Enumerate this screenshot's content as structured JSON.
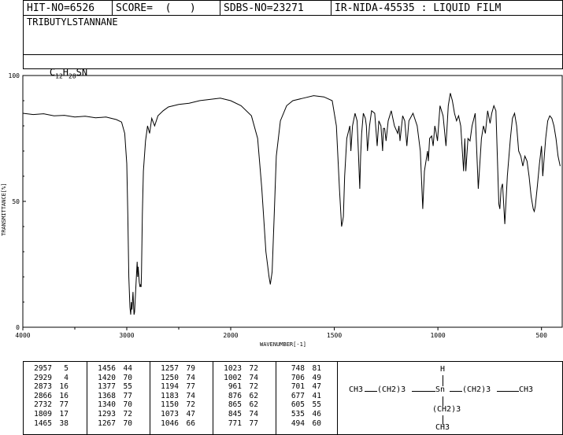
{
  "header": {
    "hit_no": "HIT-NO=6526",
    "score": "SCORE=  (   )",
    "sdbs_no": "SDBS-NO=23271",
    "ir_info": "IR-NIDA-45535 : LIQUID FILM"
  },
  "compound": {
    "name": "TRIBUTYLSTANNANE",
    "formula_parts": [
      "C",
      "12",
      "H",
      "28",
      "SN"
    ]
  },
  "chart_data": {
    "type": "line",
    "xlabel": "WAVENUMBER[-1]",
    "ylabel": "TRANSMITTANCE[%]",
    "xlim": [
      4000,
      400
    ],
    "ylim": [
      0,
      100
    ],
    "x_ticks": [
      "4000",
      "3000",
      "2000",
      "1500",
      "1000",
      "500"
    ],
    "y_ticks": [
      "100",
      "50",
      "0"
    ],
    "grid": false,
    "series": [
      {
        "points": [
          [
            4000,
            85
          ],
          [
            3900,
            84.5
          ],
          [
            3800,
            84.8
          ],
          [
            3700,
            84
          ],
          [
            3600,
            84.2
          ],
          [
            3500,
            83.5
          ],
          [
            3400,
            83.8
          ],
          [
            3300,
            83.2
          ],
          [
            3200,
            83.5
          ],
          [
            3100,
            82.5
          ],
          [
            3050,
            81.5
          ],
          [
            3020,
            77
          ],
          [
            3000,
            65
          ],
          [
            2990,
            45
          ],
          [
            2980,
            20
          ],
          [
            2970,
            8
          ],
          [
            2962,
            5
          ],
          [
            2955,
            10
          ],
          [
            2950,
            7
          ],
          [
            2940,
            14
          ],
          [
            2930,
            5
          ],
          [
            2925,
            6
          ],
          [
            2915,
            14
          ],
          [
            2900,
            26
          ],
          [
            2895,
            20
          ],
          [
            2890,
            24
          ],
          [
            2880,
            18
          ],
          [
            2873,
            16
          ],
          [
            2868,
            17
          ],
          [
            2862,
            16
          ],
          [
            2858,
            22
          ],
          [
            2850,
            45
          ],
          [
            2840,
            62
          ],
          [
            2820,
            74
          ],
          [
            2800,
            80
          ],
          [
            2780,
            77
          ],
          [
            2760,
            83
          ],
          [
            2732,
            80
          ],
          [
            2700,
            84
          ],
          [
            2650,
            86
          ],
          [
            2600,
            87.5
          ],
          [
            2500,
            88.5
          ],
          [
            2400,
            89
          ],
          [
            2300,
            90
          ],
          [
            2200,
            90.5
          ],
          [
            2100,
            91
          ],
          [
            2050,
            90.5
          ],
          [
            2000,
            90
          ],
          [
            1950,
            88
          ],
          [
            1900,
            84
          ],
          [
            1870,
            75
          ],
          [
            1850,
            55
          ],
          [
            1830,
            30
          ],
          [
            1815,
            20
          ],
          [
            1809,
            17
          ],
          [
            1800,
            22
          ],
          [
            1790,
            45
          ],
          [
            1780,
            68
          ],
          [
            1760,
            82
          ],
          [
            1730,
            88
          ],
          [
            1700,
            90
          ],
          [
            1650,
            91
          ],
          [
            1600,
            92
          ],
          [
            1550,
            91.5
          ],
          [
            1510,
            90
          ],
          [
            1490,
            80
          ],
          [
            1475,
            55
          ],
          [
            1465,
            40
          ],
          [
            1460,
            42
          ],
          [
            1456,
            44
          ],
          [
            1450,
            60
          ],
          [
            1440,
            75
          ],
          [
            1425,
            80
          ],
          [
            1420,
            70
          ],
          [
            1412,
            80
          ],
          [
            1400,
            85
          ],
          [
            1390,
            82
          ],
          [
            1384,
            70
          ],
          [
            1377,
            55
          ],
          [
            1373,
            68
          ],
          [
            1368,
            77
          ],
          [
            1360,
            85
          ],
          [
            1350,
            83
          ],
          [
            1345,
            80
          ],
          [
            1340,
            70
          ],
          [
            1330,
            80
          ],
          [
            1320,
            86
          ],
          [
            1305,
            85
          ],
          [
            1293,
            72
          ],
          [
            1285,
            82
          ],
          [
            1275,
            80
          ],
          [
            1267,
            70
          ],
          [
            1263,
            79
          ],
          [
            1257,
            79
          ],
          [
            1250,
            74
          ],
          [
            1240,
            82
          ],
          [
            1225,
            86
          ],
          [
            1210,
            80
          ],
          [
            1194,
            77
          ],
          [
            1188,
            80
          ],
          [
            1183,
            74
          ],
          [
            1170,
            84
          ],
          [
            1160,
            82
          ],
          [
            1150,
            72
          ],
          [
            1140,
            82
          ],
          [
            1120,
            85
          ],
          [
            1100,
            80
          ],
          [
            1085,
            70
          ],
          [
            1073,
            47
          ],
          [
            1065,
            62
          ],
          [
            1050,
            70
          ],
          [
            1046,
            66
          ],
          [
            1040,
            75
          ],
          [
            1030,
            76
          ],
          [
            1023,
            72
          ],
          [
            1015,
            80
          ],
          [
            1010,
            78
          ],
          [
            1002,
            74
          ],
          [
            990,
            88
          ],
          [
            975,
            84
          ],
          [
            961,
            72
          ],
          [
            950,
            88
          ],
          [
            940,
            93
          ],
          [
            930,
            90
          ],
          [
            920,
            85
          ],
          [
            910,
            82
          ],
          [
            900,
            84
          ],
          [
            890,
            80
          ],
          [
            876,
            62
          ],
          [
            870,
            75
          ],
          [
            865,
            62
          ],
          [
            855,
            75
          ],
          [
            845,
            74
          ],
          [
            835,
            80
          ],
          [
            820,
            85
          ],
          [
            805,
            55
          ],
          [
            790,
            75
          ],
          [
            780,
            80
          ],
          [
            771,
            77
          ],
          [
            760,
            86
          ],
          [
            748,
            81
          ],
          [
            740,
            85
          ],
          [
            730,
            88
          ],
          [
            720,
            86
          ],
          [
            706,
            49
          ],
          [
            701,
            47
          ],
          [
            695,
            55
          ],
          [
            688,
            57
          ],
          [
            677,
            41
          ],
          [
            665,
            60
          ],
          [
            650,
            75
          ],
          [
            640,
            83
          ],
          [
            630,
            85
          ],
          [
            620,
            80
          ],
          [
            610,
            70
          ],
          [
            600,
            68
          ],
          [
            590,
            64
          ],
          [
            580,
            68
          ],
          [
            570,
            66
          ],
          [
            560,
            60
          ],
          [
            550,
            52
          ],
          [
            540,
            47
          ],
          [
            535,
            46
          ],
          [
            530,
            48
          ],
          [
            520,
            56
          ],
          [
            510,
            65
          ],
          [
            500,
            72
          ],
          [
            494,
            60
          ],
          [
            480,
            75
          ],
          [
            470,
            82
          ],
          [
            460,
            84
          ],
          [
            450,
            83
          ],
          [
            440,
            80
          ],
          [
            430,
            75
          ],
          [
            420,
            68
          ],
          [
            410,
            64
          ]
        ]
      }
    ]
  },
  "peak_table": [
    [
      [
        "2957",
        "5"
      ],
      [
        "2929",
        "4"
      ],
      [
        "2873",
        "16"
      ],
      [
        "2866",
        "16"
      ],
      [
        "2732",
        "77"
      ],
      [
        "1809",
        "17"
      ],
      [
        "1465",
        "38"
      ]
    ],
    [
      [
        "1456",
        "44"
      ],
      [
        "1420",
        "70"
      ],
      [
        "1377",
        "55"
      ],
      [
        "1368",
        "77"
      ],
      [
        "1340",
        "70"
      ],
      [
        "1293",
        "72"
      ],
      [
        "1267",
        "70"
      ]
    ],
    [
      [
        "1257",
        "79"
      ],
      [
        "1250",
        "74"
      ],
      [
        "1194",
        "77"
      ],
      [
        "1183",
        "74"
      ],
      [
        "1150",
        "72"
      ],
      [
        "1073",
        "47"
      ],
      [
        "1046",
        "66"
      ]
    ],
    [
      [
        "1023",
        "72"
      ],
      [
        "1002",
        "74"
      ],
      [
        "961",
        "72"
      ],
      [
        "876",
        "62"
      ],
      [
        "865",
        "62"
      ],
      [
        "845",
        "74"
      ],
      [
        "771",
        "77"
      ]
    ],
    [
      [
        "748",
        "81"
      ],
      [
        "706",
        "49"
      ],
      [
        "701",
        "47"
      ],
      [
        "677",
        "41"
      ],
      [
        "605",
        "55"
      ],
      [
        "535",
        "46"
      ],
      [
        "494",
        "60"
      ]
    ]
  ],
  "structure": {
    "h_atom": "H",
    "left_ch3": "CH3",
    "left_chain": "(CH2)3",
    "center": "Sn",
    "right_chain": "(CH2)3",
    "right_ch3": "CH3",
    "bottom_chain": "(CH2)3",
    "bottom_ch3": "CH3"
  }
}
